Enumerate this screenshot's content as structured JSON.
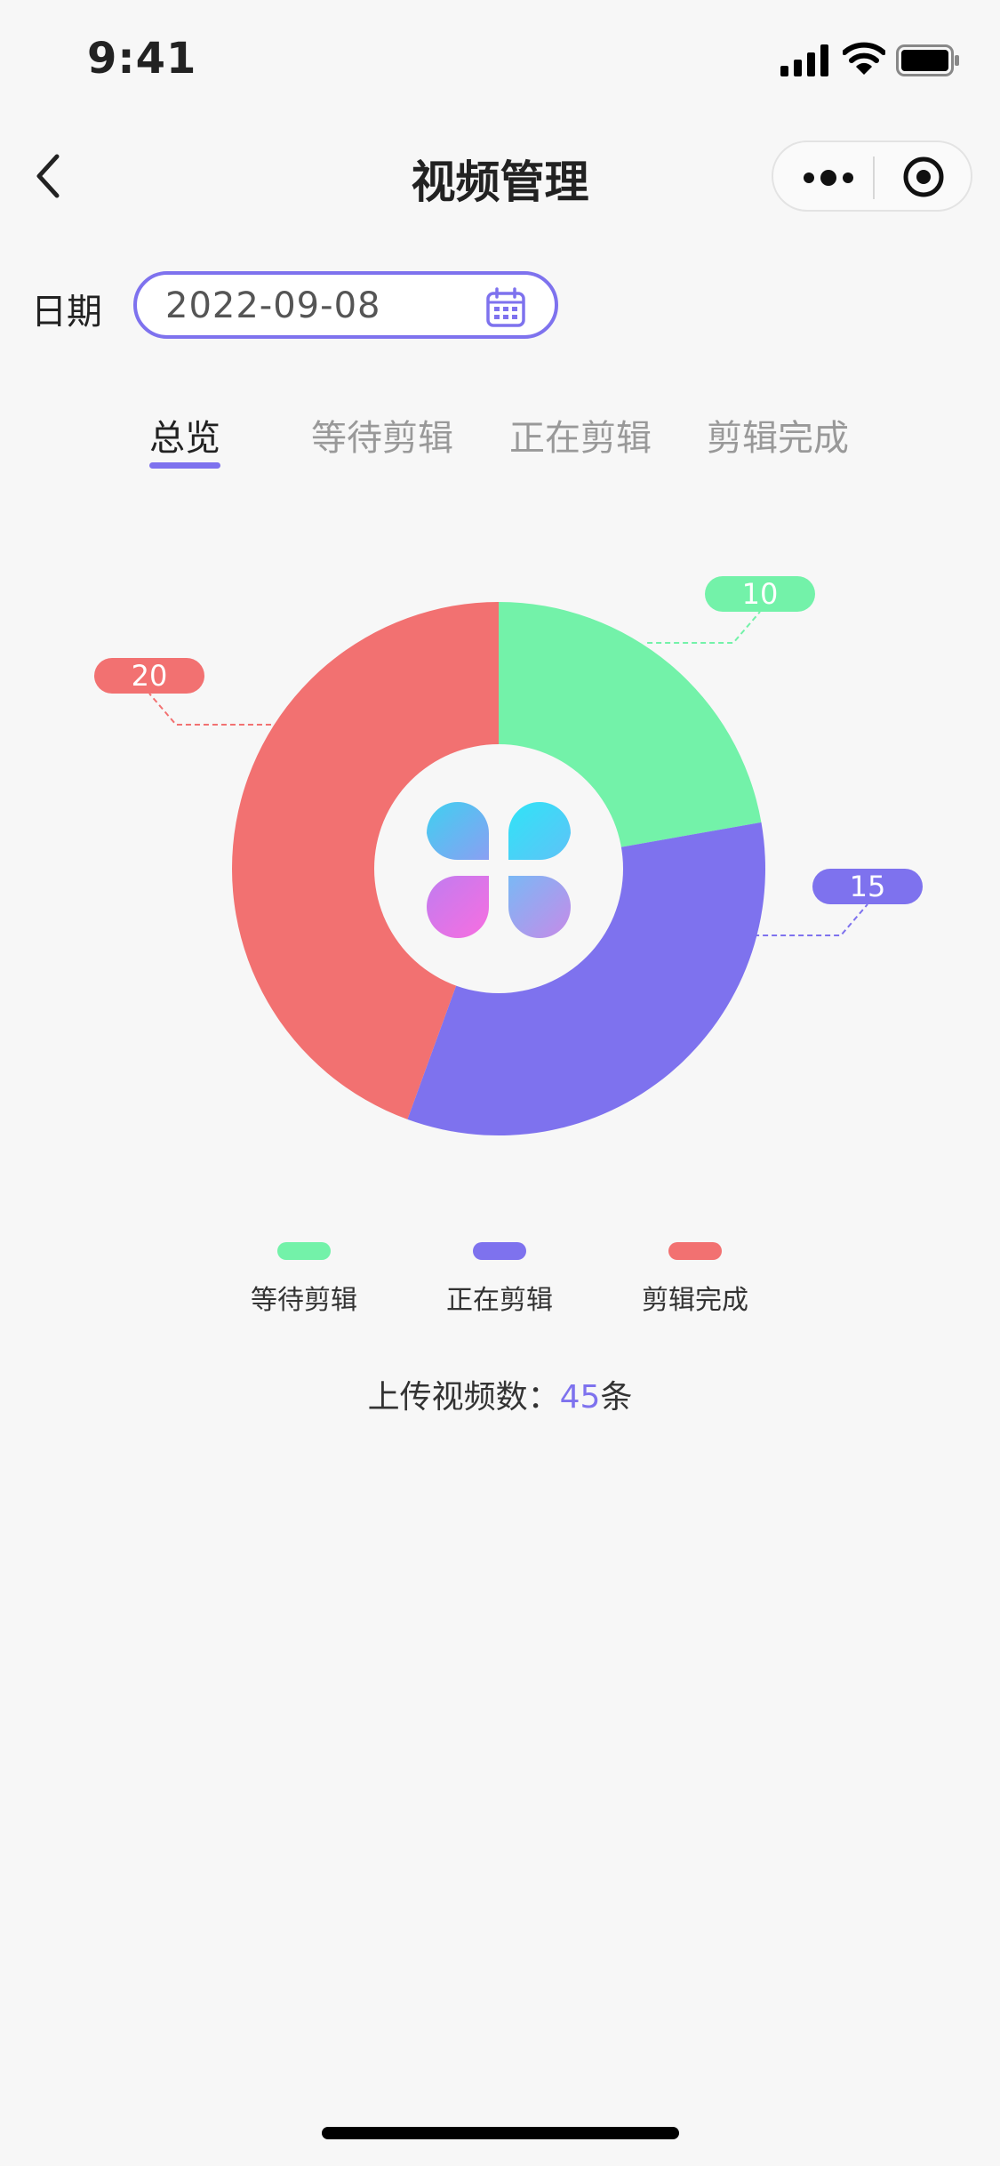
{
  "status_bar": {
    "time": "9:41"
  },
  "nav": {
    "title": "视频管理"
  },
  "date": {
    "label": "日期",
    "value": "2022-09-08"
  },
  "tabs": [
    {
      "label": "总览",
      "active": true
    },
    {
      "label": "等待剪辑",
      "active": false
    },
    {
      "label": "正在剪辑",
      "active": false
    },
    {
      "label": "剪辑完成",
      "active": false
    }
  ],
  "chart_data": {
    "type": "pie",
    "donut": true,
    "categories": [
      "等待剪辑",
      "正在剪辑",
      "剪辑完成"
    ],
    "values": [
      10,
      15,
      20
    ],
    "colors": [
      "#73f2a9",
      "#7e72ee",
      "#f27171"
    ],
    "legend_placement": "bottom"
  },
  "legend": [
    {
      "label": "等待剪辑",
      "color": "#73f2a9"
    },
    {
      "label": "正在剪辑",
      "color": "#7e72ee"
    },
    {
      "label": "剪辑完成",
      "color": "#f27171"
    }
  ],
  "summary": {
    "label": "上传视频数：",
    "count": "45",
    "unit": "条"
  },
  "colors": {
    "accent": "#7e72ee",
    "background": "#f7f7f7"
  }
}
